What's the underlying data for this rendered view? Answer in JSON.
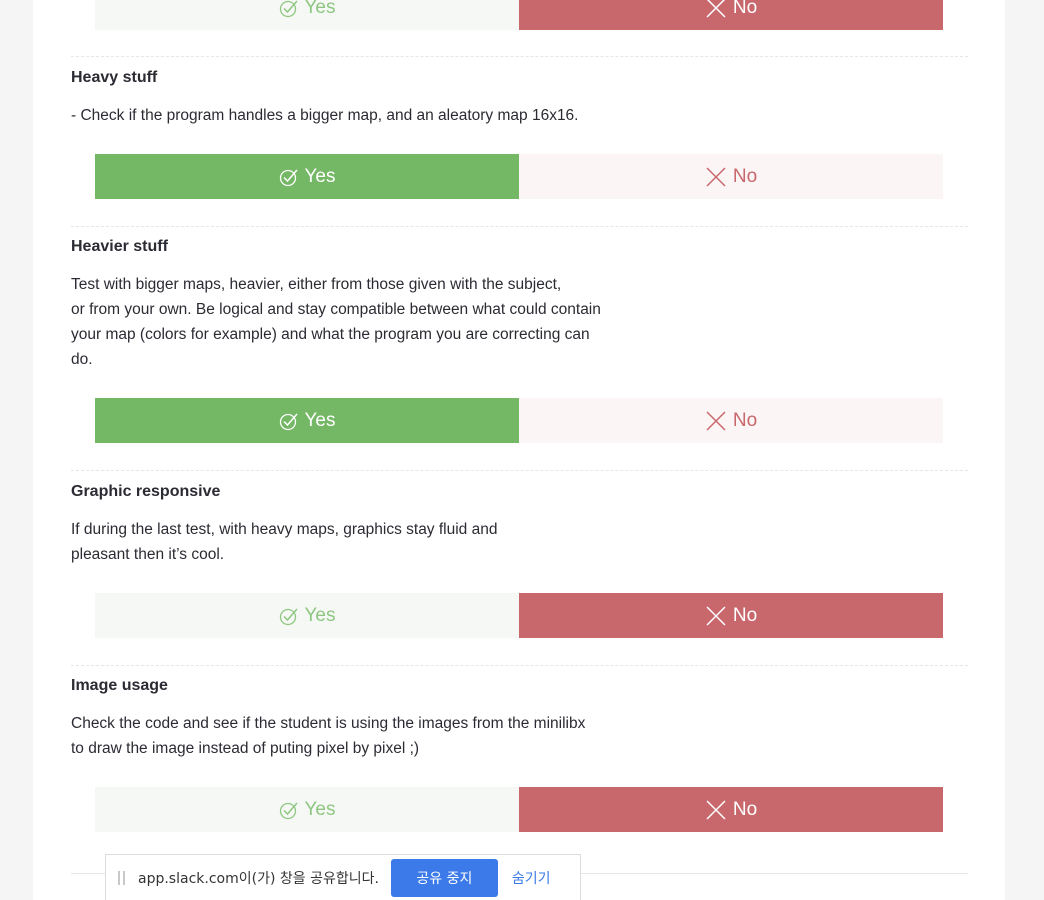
{
  "buttons": {
    "yes_label": "Yes",
    "no_label": "No"
  },
  "colors": {
    "yes_active": "#74b765",
    "no_active": "#c8686c"
  },
  "sections": [
    {
      "title": "",
      "description": "",
      "answer": "no"
    },
    {
      "title": "Heavy stuff",
      "description": "- Check if the program handles a bigger map, and an aleatory map 16x16.",
      "answer": "yes"
    },
    {
      "title": "Heavier stuff",
      "description": "Test with bigger maps, heavier, either from those given with the subject,\nor from your own. Be logical and stay compatible between what could contain\nyour map (colors for example) and what the program you are correcting can\ndo.",
      "answer": "yes"
    },
    {
      "title": "Graphic responsive",
      "description": "If during the last test, with heavy maps, graphics stay fluid and\npleasant then it’s cool.",
      "answer": "no"
    },
    {
      "title": "Image usage",
      "description": "Check the code and see if the student is using the images from the minilibx\nto draw the image instead of puting pixel by pixel ;)",
      "answer": "no"
    }
  ],
  "share_bar": {
    "text": "app.slack.com이(가) 창을 공유합니다.",
    "stop_label": "공유 중지",
    "hide_label": "숨기기"
  }
}
